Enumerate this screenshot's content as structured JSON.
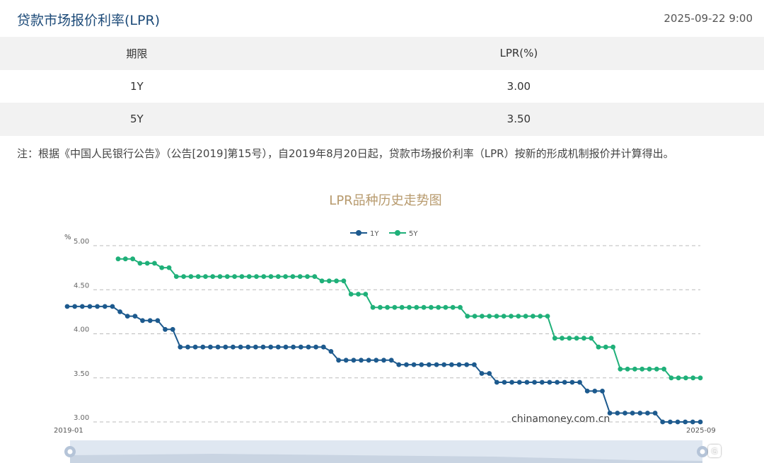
{
  "header": {
    "title": "贷款市场报价利率(LPR)",
    "timestamp": "2025-09-22 9:00"
  },
  "table": {
    "headers": [
      "期限",
      "LPR(%)"
    ],
    "rows": [
      {
        "term": "1Y",
        "rate": "3.00"
      },
      {
        "term": "5Y",
        "rate": "3.50"
      }
    ]
  },
  "note": "注：根据《中国人民银行公告》（公告[2019]第15号），自2019年8月20日起，贷款市场报价利率（LPR）按新的形成机制报价并计算得出。",
  "chart_data": {
    "type": "line",
    "title": "LPR品种历史走势图",
    "y_unit_label": "%",
    "ylim": [
      3.0,
      5.0
    ],
    "y_ticks": [
      "5.00",
      "4.50",
      "4.00",
      "3.50",
      "3.00"
    ],
    "x_range_labels": [
      "2019-01",
      "2025-09"
    ],
    "grid": true,
    "legend_position": "top-center",
    "watermark": "chinamoney.com.cn",
    "colors": {
      "1Y": "#1d5a8e",
      "5Y": "#1fb079",
      "grid": "#bbbbbb"
    },
    "series": [
      {
        "name": "1Y",
        "values": [
          4.31,
          4.31,
          4.31,
          4.31,
          4.31,
          4.31,
          4.31,
          4.25,
          4.2,
          4.2,
          4.15,
          4.15,
          4.15,
          4.05,
          4.05,
          3.85,
          3.85,
          3.85,
          3.85,
          3.85,
          3.85,
          3.85,
          3.85,
          3.85,
          3.85,
          3.85,
          3.85,
          3.85,
          3.85,
          3.85,
          3.85,
          3.85,
          3.85,
          3.85,
          3.85,
          3.8,
          3.7,
          3.7,
          3.7,
          3.7,
          3.7,
          3.7,
          3.7,
          3.7,
          3.65,
          3.65,
          3.65,
          3.65,
          3.65,
          3.65,
          3.65,
          3.65,
          3.65,
          3.65,
          3.65,
          3.55,
          3.55,
          3.45,
          3.45,
          3.45,
          3.45,
          3.45,
          3.45,
          3.45,
          3.45,
          3.45,
          3.45,
          3.45,
          3.45,
          3.35,
          3.35,
          3.35,
          3.1,
          3.1,
          3.1,
          3.1,
          3.1,
          3.1,
          3.1,
          3.0,
          3.0,
          3.0,
          3.0,
          3.0,
          3.0
        ]
      },
      {
        "name": "5Y",
        "values": [
          null,
          null,
          null,
          null,
          null,
          null,
          null,
          4.85,
          4.85,
          4.85,
          4.8,
          4.8,
          4.8,
          4.75,
          4.75,
          4.65,
          4.65,
          4.65,
          4.65,
          4.65,
          4.65,
          4.65,
          4.65,
          4.65,
          4.65,
          4.65,
          4.65,
          4.65,
          4.65,
          4.65,
          4.65,
          4.65,
          4.65,
          4.65,
          4.65,
          4.6,
          4.6,
          4.6,
          4.6,
          4.45,
          4.45,
          4.45,
          4.3,
          4.3,
          4.3,
          4.3,
          4.3,
          4.3,
          4.3,
          4.3,
          4.3,
          4.3,
          4.3,
          4.3,
          4.3,
          4.2,
          4.2,
          4.2,
          4.2,
          4.2,
          4.2,
          4.2,
          4.2,
          4.2,
          4.2,
          4.2,
          4.2,
          3.95,
          3.95,
          3.95,
          3.95,
          3.95,
          3.95,
          3.85,
          3.85,
          3.85,
          3.6,
          3.6,
          3.6,
          3.6,
          3.6,
          3.6,
          3.6,
          3.5,
          3.5,
          3.5,
          3.5,
          3.5
        ]
      }
    ]
  }
}
